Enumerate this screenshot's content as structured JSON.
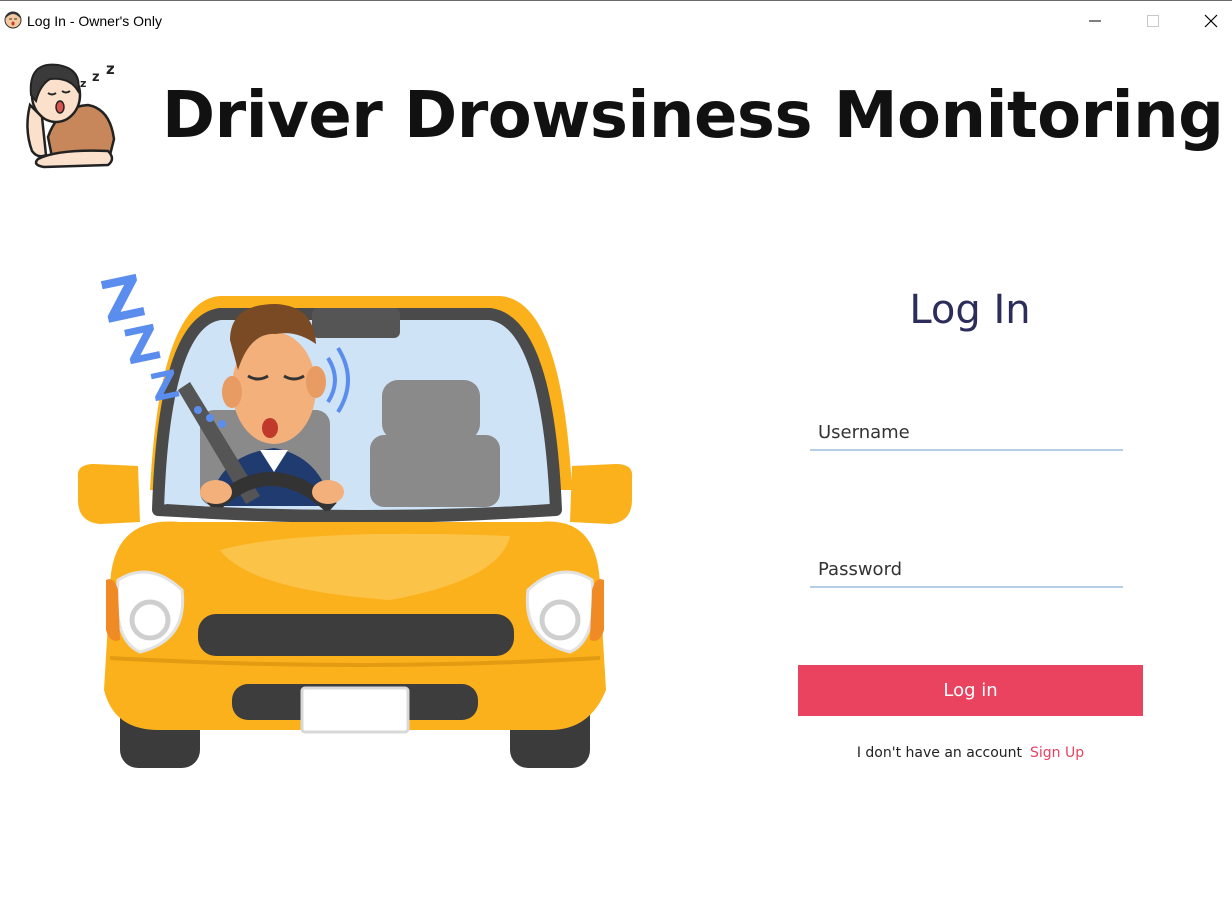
{
  "window": {
    "title": "Log In - Owner's Only",
    "icon": "sleepy-face-icon",
    "controls": [
      "minimize-icon",
      "maximize-icon",
      "close-icon"
    ]
  },
  "header": {
    "logo": "sleeping-person-logo",
    "title": "Driver Drowsiness Monitoring"
  },
  "illustration": {
    "name": "drowsy-driver-in-yellow-car",
    "accent_colors": {
      "car_body": "#fbb11b",
      "zzz": "#5b8dee"
    }
  },
  "login": {
    "heading": "Log In",
    "username": {
      "value": "",
      "placeholder": "Username"
    },
    "password": {
      "value": "",
      "placeholder": "Password"
    },
    "submit_label": "Log in",
    "no_account_text": "I don't have an account",
    "signup_label": "Sign Up"
  },
  "colors": {
    "accent": "#e9435f",
    "heading": "#2c2d5a",
    "field_underline": "#b5cfe6"
  }
}
